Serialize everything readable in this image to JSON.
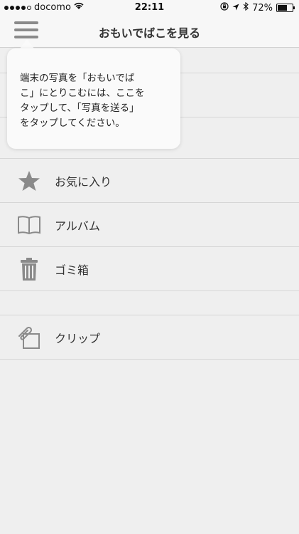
{
  "status_bar": {
    "carrier": "docomo",
    "time": "22:11",
    "battery_percent": "72%",
    "battery_level": 0.72,
    "signal_bars_filled": 4,
    "icons": [
      "wifi-icon",
      "orientation-lock-icon",
      "location-arrow-icon",
      "bluetooth-icon",
      "battery-icon"
    ]
  },
  "navbar": {
    "title": "おもいでばこを見る",
    "menu_icon": "hamburger-menu-icon"
  },
  "tooltip": {
    "text": "端末の写真を「おもいでば\nこ」にとりこむには、ここを\nタップして、「写真を送る」\nをタップしてください。"
  },
  "menu": {
    "items": [
      {
        "label": "お気に入り",
        "icon": "star-icon"
      },
      {
        "label": "アルバム",
        "icon": "book-icon"
      },
      {
        "label": "ゴミ箱",
        "icon": "trash-icon"
      },
      {
        "label": "クリップ",
        "icon": "clip-icon"
      }
    ]
  },
  "colors": {
    "background": "#efefef",
    "bar_background": "#f7f7f7",
    "icon_gray": "#8a8a8a",
    "divider": "#d6d6d6"
  }
}
